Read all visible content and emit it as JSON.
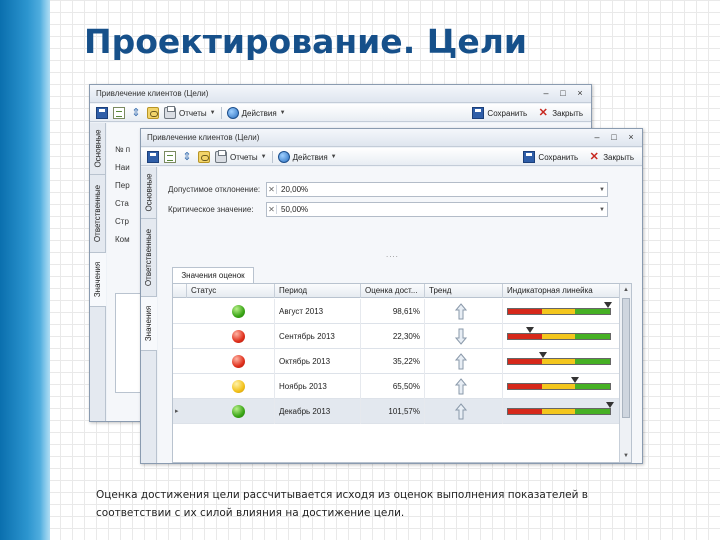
{
  "slide": {
    "title": "Проектирование. Цели",
    "caption": "Оценка достижения цели рассчитывается исходя из оценок выполнения показателей в соответствии с их силой влияния на достижение цели.",
    "colors": {
      "title": "#16508a",
      "band": "#2c95cf"
    }
  },
  "back_window": {
    "title": "Привлечение клиентов (Цели)",
    "toolbar": {
      "reports": "Отчеты",
      "actions": "Действия",
      "save": "Сохранить",
      "close": "Закрыть"
    },
    "tabs": [
      "Значения",
      "Ответственные",
      "Основные"
    ],
    "labels": [
      "№ п",
      "Наи",
      "Пер",
      "Ста",
      "Стр",
      "Ком"
    ]
  },
  "front_window": {
    "title": "Привлечение клиентов (Цели)",
    "toolbar": {
      "reports": "Отчеты",
      "actions": "Действия",
      "save": "Сохранить",
      "close": "Закрыть"
    },
    "tabs": [
      "Значения",
      "Ответственные",
      "Основные"
    ],
    "fields": {
      "acceptable_label": "Допустимое отклонение:",
      "acceptable_value": "20,00%",
      "critical_label": "Критическое значение:",
      "critical_value": "50,00%"
    },
    "dots": "....",
    "section_tab": "Значения оценок",
    "grid": {
      "columns": [
        "Статус",
        "Период",
        "Оценка дост...",
        "Тренд",
        "Индикаторная линейка"
      ],
      "rows": [
        {
          "status": "green",
          "period": "Август 2013",
          "score": "98,61%",
          "trend": "up",
          "marker": 0.97
        },
        {
          "status": "red",
          "period": "Сентябрь 2013",
          "score": "22,30%",
          "trend": "down",
          "marker": 0.22
        },
        {
          "status": "red",
          "period": "Октябрь 2013",
          "score": "35,22%",
          "trend": "up",
          "marker": 0.35
        },
        {
          "status": "yellow",
          "period": "Ноябрь 2013",
          "score": "65,50%",
          "trend": "up",
          "marker": 0.65
        },
        {
          "status": "green",
          "period": "Декабрь 2013",
          "score": "101,57%",
          "trend": "up",
          "marker": 0.99
        }
      ]
    }
  }
}
